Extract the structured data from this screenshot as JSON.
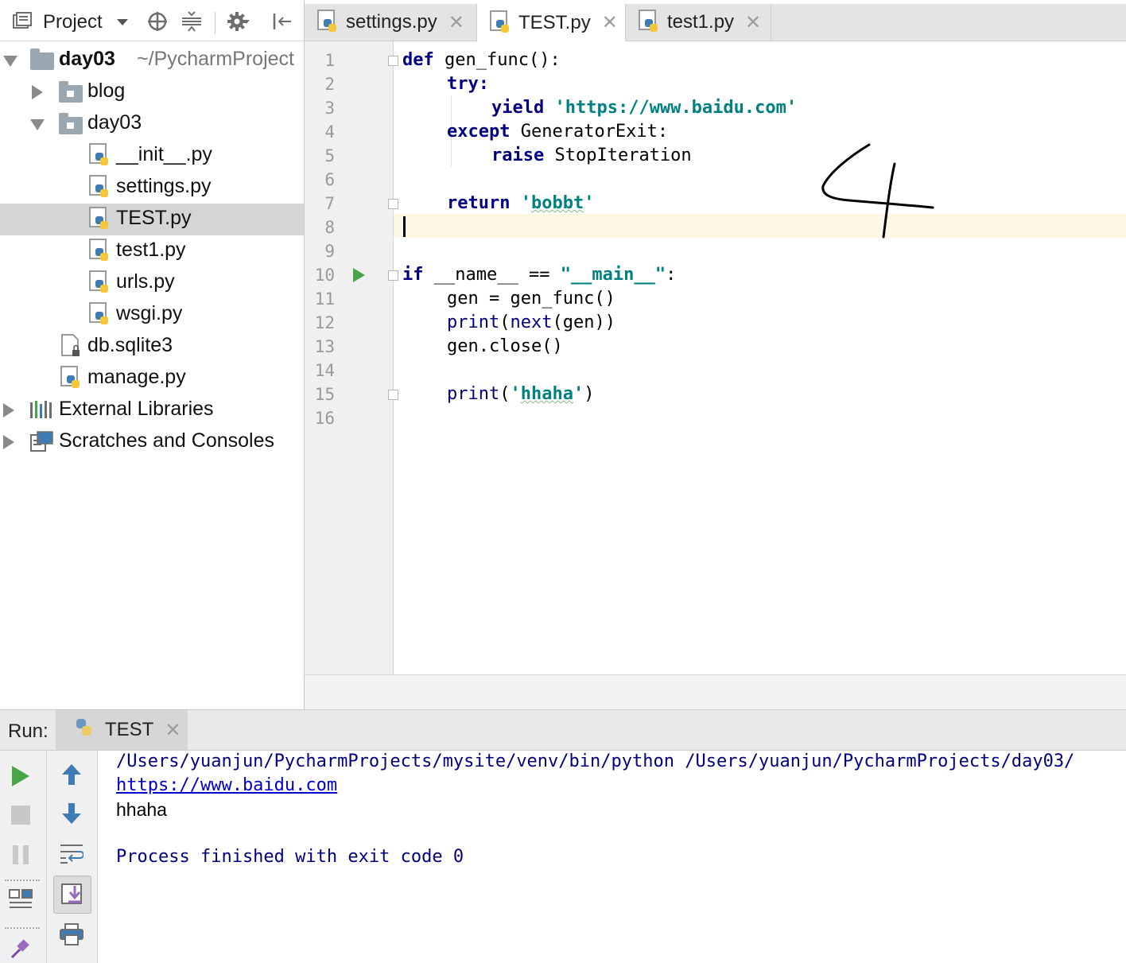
{
  "project_panel": {
    "title": "Project",
    "tree": [
      {
        "label": "day03",
        "path": "~/PycharmProject"
      },
      {
        "label": "blog"
      },
      {
        "label": "day03"
      },
      {
        "label": "__init__.py"
      },
      {
        "label": "settings.py"
      },
      {
        "label": "TEST.py",
        "selected": true
      },
      {
        "label": "test1.py"
      },
      {
        "label": "urls.py"
      },
      {
        "label": "wsgi.py"
      },
      {
        "label": "db.sqlite3"
      },
      {
        "label": "manage.py"
      },
      {
        "label": "External Libraries"
      },
      {
        "label": "Scratches and Consoles"
      }
    ]
  },
  "editor_tabs": [
    {
      "label": "settings.py"
    },
    {
      "label": "TEST.py",
      "active": true
    },
    {
      "label": "test1.py"
    }
  ],
  "editor": {
    "line_numbers": [
      "1",
      "2",
      "3",
      "4",
      "5",
      "6",
      "7",
      "8",
      "9",
      "10",
      "11",
      "12",
      "13",
      "14",
      "15",
      "16"
    ],
    "code": {
      "l1_kw": "def",
      "l1_rest": " gen_func():",
      "l2_kw": "try",
      "l2_rest": ":",
      "l3_kw": "yield",
      "l3_str": "'https://www.baidu.com'",
      "l4_kw": "except",
      "l4_rest": " GeneratorExit:",
      "l5_kw": "raise",
      "l5_rest": " StopIteration",
      "l7_kw": "return",
      "l7_str_a": "'",
      "l7_str_b": "bobbt",
      "l7_str_c": "'",
      "l10_kw": "if",
      "l10_rest": " __name__ == ",
      "l10_str": "\"__main__\"",
      "l10_end": ":",
      "l11": "gen = gen_func()",
      "l12_a": "print",
      "l12_b": "(",
      "l12_c": "next",
      "l12_d": "(gen))",
      "l13": "gen.close()",
      "l15_a": "print",
      "l15_b": "(",
      "l15_str_a": "'",
      "l15_str_b": "hhaha",
      "l15_str_c": "'",
      "l15_end": ")"
    },
    "current_line": "8"
  },
  "annotation": {
    "handwritten": "4",
    "color": "#000000"
  },
  "run_panel": {
    "label": "Run:",
    "tab_label": "TEST",
    "console": {
      "cmd": "/Users/yuanjun/PycharmProjects/mysite/venv/bin/python /Users/yuanjun/PycharmProjects/day03/",
      "link": "https://www.baidu.com",
      "out": "hhaha",
      "exit": "Process finished with exit code 0"
    }
  },
  "colors": {
    "keyword": "#000080",
    "string": "#008080",
    "current_line_bg": "#fdf8e3",
    "run_green": "#4aa54a",
    "selected_bg": "#d5d5d5"
  },
  "icons": [
    "project-view-icon",
    "locate-icon",
    "collapse-icon",
    "gear-icon",
    "hide-panel-icon",
    "python-file-icon",
    "folder-icon",
    "run-icon",
    "stop-icon",
    "pause-icon",
    "arrow-up-icon",
    "arrow-down-icon",
    "soft-wrap-icon",
    "scroll-to-end-icon",
    "print-icon",
    "layout-icon",
    "pin-icon"
  ]
}
